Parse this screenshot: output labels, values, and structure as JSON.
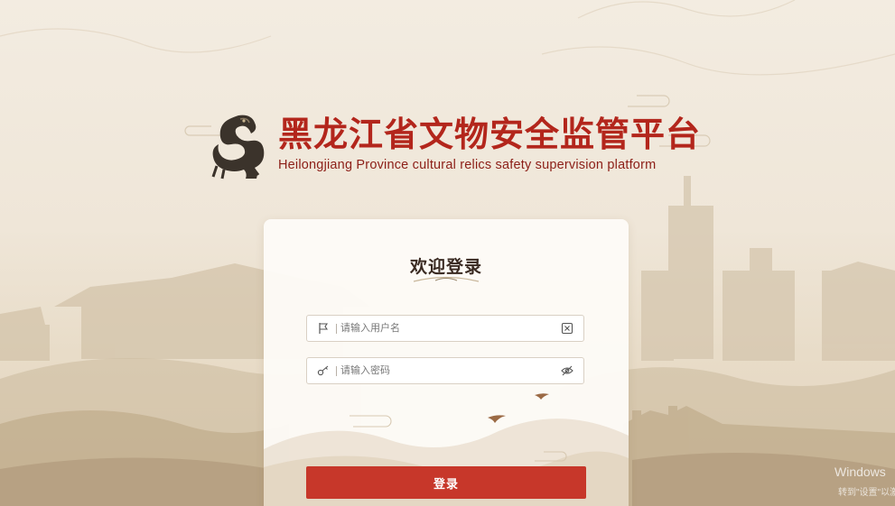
{
  "brand": {
    "title": "黑龙江省文物安全监管平台",
    "subtitle": "Heilongjiang Province cultural relics safety supervision platform"
  },
  "login": {
    "heading": "欢迎登录",
    "username_placeholder": "请输入用户名",
    "password_placeholder": "请输入密码",
    "submit_label": "登录"
  },
  "icons": {
    "username_lead": "flag-icon",
    "username_trail": "clear-input-icon",
    "password_lead": "key-icon",
    "password_trail": "eye-hidden-icon",
    "emblem": "dragon-emblem-icon"
  },
  "watermark": {
    "line1": "Windows",
    "line2": "转到\"设置\"以激活 W"
  },
  "colors": {
    "accent": "#c7372a",
    "brand_text": "#b3261c",
    "background": "#f3ece1"
  }
}
